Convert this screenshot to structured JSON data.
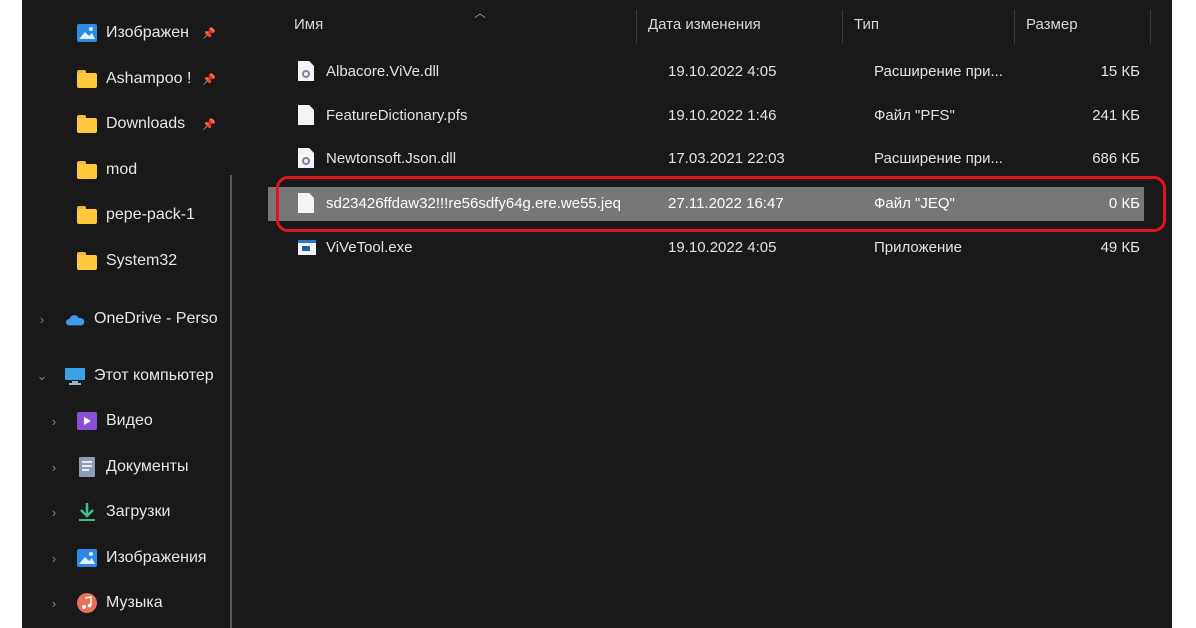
{
  "sidebar": {
    "pinned": [
      {
        "label": "Изображен",
        "icon": "pictures-icon"
      },
      {
        "label": "Ashampoo !",
        "icon": "folder-icon"
      },
      {
        "label": "Downloads",
        "icon": "folder-icon"
      },
      {
        "label": "mod",
        "icon": "folder-icon"
      },
      {
        "label": "pepe-pack-1",
        "icon": "folder-icon"
      },
      {
        "label": "System32",
        "icon": "folder-icon"
      }
    ],
    "onedrive": {
      "label": "OneDrive - Perso",
      "icon": "cloud-icon"
    },
    "this_pc": {
      "label": "Этот компьютер",
      "icon": "monitor-icon"
    },
    "pc_items": [
      {
        "label": "Видео",
        "icon": "video-icon"
      },
      {
        "label": "Документы",
        "icon": "documents-icon"
      },
      {
        "label": "Загрузки",
        "icon": "download-icon"
      },
      {
        "label": "Изображения",
        "icon": "pictures-icon"
      },
      {
        "label": "Музыка",
        "icon": "music-icon"
      }
    ]
  },
  "columns": {
    "name": "Имя",
    "date": "Дата изменения",
    "type": "Тип",
    "size": "Размер"
  },
  "files": [
    {
      "name": "Albacore.ViVe.dll",
      "date": "19.10.2022 4:05",
      "type": "Расширение при...",
      "size": "15 КБ",
      "icon": "dll-file-icon"
    },
    {
      "name": "FeatureDictionary.pfs",
      "date": "19.10.2022 1:46",
      "type": "Файл \"PFS\"",
      "size": "241 КБ",
      "icon": "file-icon"
    },
    {
      "name": "Newtonsoft.Json.dll",
      "date": "17.03.2021 22:03",
      "type": "Расширение при...",
      "size": "686 КБ",
      "icon": "dll-file-icon"
    },
    {
      "name": "sd23426ffdaw32!!!re56sdfy64g.ere.we55.jeq",
      "date": "27.11.2022 16:47",
      "type": "Файл \"JEQ\"",
      "size": "0 КБ",
      "icon": "file-icon",
      "selected": true
    },
    {
      "name": "ViVeTool.exe",
      "date": "19.10.2022 4:05",
      "type": "Приложение",
      "size": "49 КБ",
      "icon": "exe-icon"
    }
  ],
  "colors": {
    "background": "#191919",
    "selection": "#777777",
    "highlight_ring": "#e0141e",
    "folder": "#ffc83d"
  }
}
